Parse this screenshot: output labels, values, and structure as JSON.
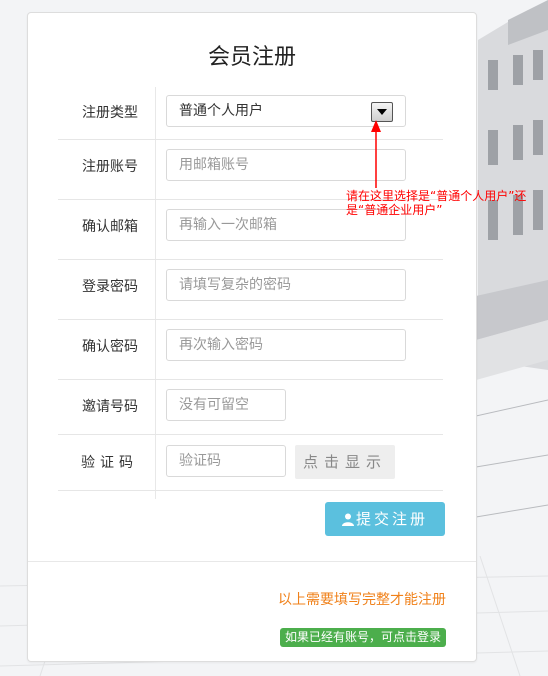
{
  "form": {
    "title": "会员注册",
    "fields": {
      "type": {
        "label": "注册类型",
        "value": "普通个人用户"
      },
      "account": {
        "label": "注册账号",
        "placeholder": "用邮箱账号"
      },
      "confirm_email": {
        "label": "确认邮箱",
        "placeholder": "再输入一次邮箱"
      },
      "password": {
        "label": "登录密码",
        "placeholder": "请填写复杂的密码"
      },
      "confirm_password": {
        "label": "确认密码",
        "placeholder": "再次输入密码"
      },
      "invite": {
        "label": "邀请号码",
        "placeholder": "没有可留空"
      },
      "captcha": {
        "label": "验证码",
        "placeholder": "验证码",
        "button": "点击显示"
      }
    },
    "submit_label": "提交注册",
    "note": "以上需要填写完整才能注册",
    "login_link": "如果已经有账号，可点击登录"
  },
  "annotation": {
    "text": "请在这里选择是“普通个人用户”还是“普通企业用户”",
    "color": "#ff0000"
  },
  "colors": {
    "submit": "#5bc0de",
    "note": "#f0811a",
    "login_badge": "#4cae4c"
  },
  "icons": {
    "submit": "user-icon",
    "select": "dropdown-arrow-icon"
  }
}
